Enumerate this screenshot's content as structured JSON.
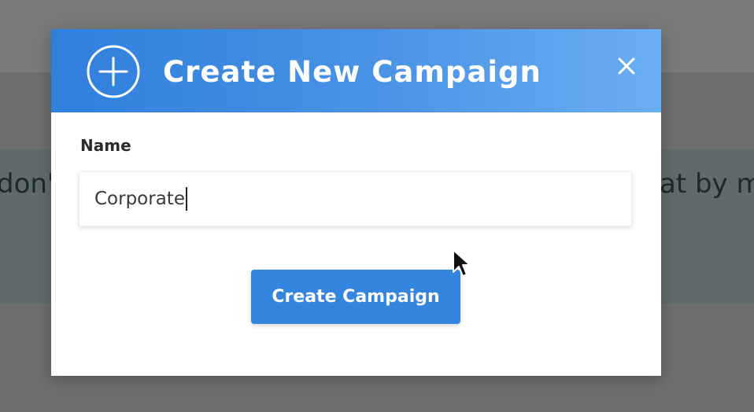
{
  "background": {
    "text_left": "don'",
    "text_right": "at by m"
  },
  "modal": {
    "title": "Create New Campaign",
    "header_icon": "plus-circle-icon",
    "close_icon": "close-icon",
    "name_field": {
      "label": "Name",
      "value": "Corporate"
    },
    "submit_label": "Create Campaign"
  },
  "colors": {
    "header_start": "#2f7fdd",
    "header_end": "#6aaef2",
    "button": "#3385e0",
    "overlay": "#6e6e6e"
  }
}
